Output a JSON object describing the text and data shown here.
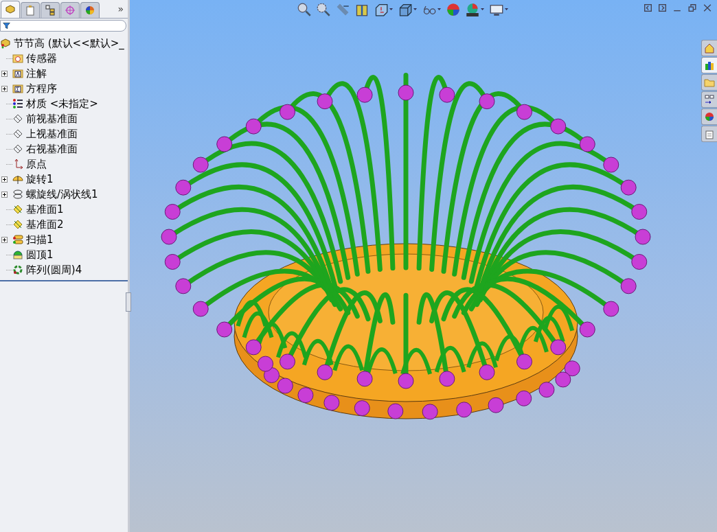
{
  "panel_tabs": [
    {
      "kind": "feature",
      "selected": true
    },
    {
      "kind": "property",
      "selected": false
    },
    {
      "kind": "config",
      "selected": false
    },
    {
      "kind": "dim",
      "selected": false
    },
    {
      "kind": "display",
      "selected": false
    }
  ],
  "panel_more": "»",
  "task_pane_tabs": [
    {
      "kind": "home",
      "selected": false
    },
    {
      "kind": "library",
      "selected": true
    },
    {
      "kind": "explorer",
      "selected": false
    },
    {
      "kind": "views",
      "selected": false
    },
    {
      "kind": "appearance",
      "selected": false
    },
    {
      "kind": "properties",
      "selected": false
    }
  ],
  "feature_tree": {
    "root": "节节高  (默认<<默认>_",
    "items": [
      {
        "label": "传感器",
        "kind": "sensor",
        "collapsible": false
      },
      {
        "label": "注解",
        "kind": "annotation",
        "collapsible": true
      },
      {
        "label": "方程序",
        "kind": "equation",
        "collapsible": true
      },
      {
        "label": "材质 <未指定>",
        "kind": "material",
        "collapsible": false
      },
      {
        "label": "前视基准面",
        "kind": "plane",
        "collapsible": false
      },
      {
        "label": "上视基准面",
        "kind": "plane",
        "collapsible": false
      },
      {
        "label": "右视基准面",
        "kind": "plane",
        "collapsible": false
      },
      {
        "label": "原点",
        "kind": "origin",
        "collapsible": false
      },
      {
        "label": "旋转1",
        "kind": "revolve",
        "collapsible": true
      },
      {
        "label": "螺旋线/涡状线1",
        "kind": "helix",
        "collapsible": true
      },
      {
        "label": "基准面1",
        "kind": "refplane",
        "collapsible": false
      },
      {
        "label": "基准面2",
        "kind": "refplane",
        "collapsible": false
      },
      {
        "label": "扫描1",
        "kind": "sweep",
        "collapsible": true
      },
      {
        "label": "圆顶1",
        "kind": "dome",
        "collapsible": false
      },
      {
        "label": "阵列(圆周)4",
        "kind": "pattern",
        "collapsible": false
      }
    ]
  }
}
